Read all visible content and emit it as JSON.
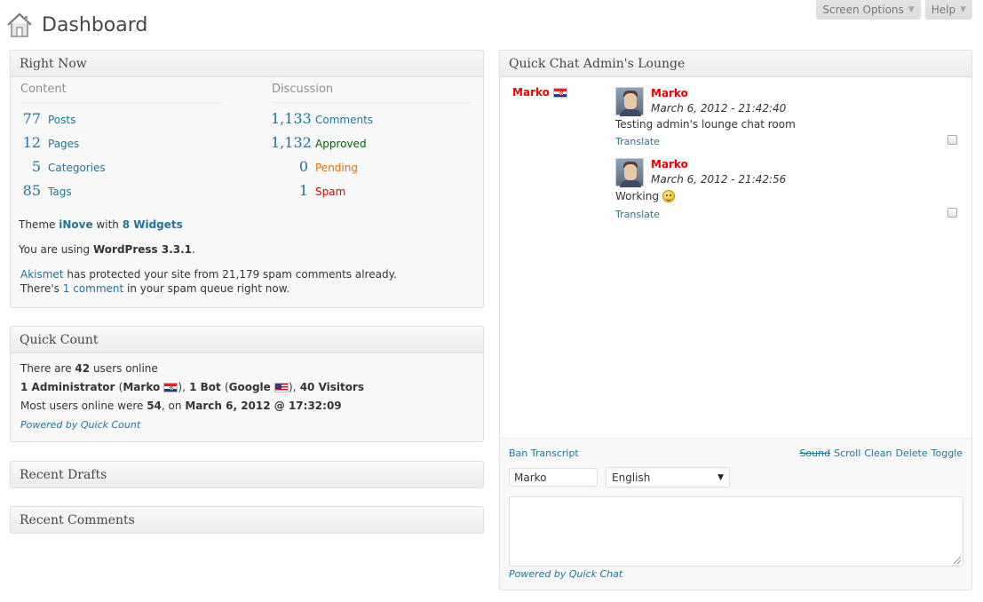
{
  "header": {
    "title": "Dashboard",
    "screen_options": "Screen Options",
    "help": "Help"
  },
  "right_now": {
    "title": "Right Now",
    "content_heading": "Content",
    "discussion_heading": "Discussion",
    "content": [
      {
        "count": "77",
        "label": "Posts"
      },
      {
        "count": "12",
        "label": "Pages"
      },
      {
        "count": "5",
        "label": "Categories"
      },
      {
        "count": "85",
        "label": "Tags"
      }
    ],
    "discussion": [
      {
        "count": "1,133",
        "label": "Comments",
        "color": "#21759b"
      },
      {
        "count": "1,132",
        "label": "Approved",
        "color": "#006505"
      },
      {
        "count": "0",
        "label": "Pending",
        "color": "#e66f00"
      },
      {
        "count": "1",
        "label": "Spam",
        "color": "#e00000"
      }
    ],
    "theme_prefix": "Theme",
    "theme_name": "iNove",
    "theme_with": "with",
    "widgets": "8 Widgets",
    "version_prefix": "You are using",
    "version": "WordPress 3.3.1",
    "version_suffix": ".",
    "akismet_link": "Akismet",
    "akismet_text": "has protected your site from 21,179 spam comments already.",
    "spam_prefix": "There's",
    "spam_link": "1 comment",
    "spam_suffix": "in your spam queue right now."
  },
  "quick_count": {
    "title": "Quick Count",
    "line1_prefix": "There are",
    "line1_count": "42",
    "line1_suffix": "users online",
    "admin_count": "1 Administrator",
    "admin_name": "Marko",
    "bot_count": "1 Bot",
    "bot_name": "Google",
    "visitors": "40 Visitors",
    "most_prefix": "Most users online were",
    "most_count": "54",
    "most_on": ", on",
    "most_date": "March 6, 2012 @ 17:32:09",
    "powered": "Powered by Quick Count"
  },
  "recent_drafts": {
    "title": "Recent Drafts"
  },
  "recent_comments": {
    "title": "Recent Comments"
  },
  "quick_chat": {
    "title": "Quick Chat Admin's Lounge",
    "online_user": "Marko",
    "messages": [
      {
        "author": "Marko",
        "time": "March 6, 2012 - 21:42:40",
        "text": "Testing admin's lounge chat room",
        "translate": "Translate"
      },
      {
        "author": "Marko",
        "time": "March 6, 2012 - 21:42:56",
        "text": "Working",
        "translate": "Translate"
      }
    ],
    "left_links": "Ban Transcript",
    "sound": "Sound",
    "scroll": "Scroll",
    "clean": "Clean",
    "delete": "Delete",
    "toggle": "Toggle",
    "name_value": "Marko",
    "language": "English",
    "powered": "Powered by Quick Chat"
  }
}
